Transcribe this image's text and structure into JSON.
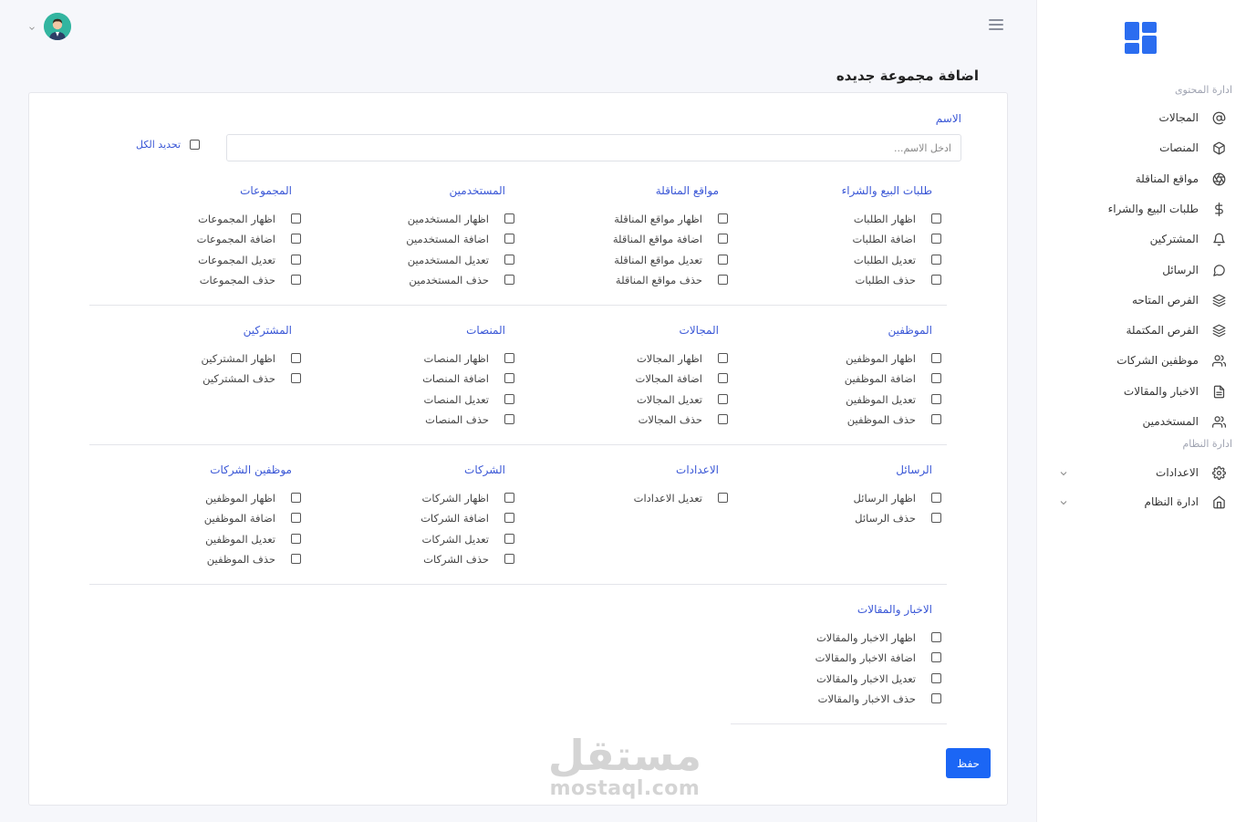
{
  "page_title": "اضافة مجموعة جديده",
  "form": {
    "name_label": "الاسم",
    "name_placeholder": "ادخل الاسم...",
    "name_value": "",
    "select_all_label": "تحديد الكل",
    "save_label": "حفظ"
  },
  "groups": [
    {
      "title": "طلبات البيع والشراء",
      "items": [
        "اظهار الطلبات",
        "اضافة الطلبات",
        "تعديل الطلبات",
        "حذف الطلبات"
      ]
    },
    {
      "title": "مواقع المناقلة",
      "items": [
        "اظهار مواقع المناقلة",
        "اضافة مواقع المناقلة",
        "تعديل مواقع المناقلة",
        "حذف مواقع المناقلة"
      ]
    },
    {
      "title": "المستخدمين",
      "items": [
        "اظهار المستخدمين",
        "اضافة المستخدمين",
        "تعديل المستخدمين",
        "حذف المستخدمين"
      ]
    },
    {
      "title": "المجموعات",
      "items": [
        "اظهار المجموعات",
        "اضافة المجموعات",
        "تعديل المجموعات",
        "حذف المجموعات"
      ]
    },
    {
      "title": "الموظفين",
      "items": [
        "اظهار الموظفين",
        "اضافة الموظفين",
        "تعديل الموظفين",
        "حذف الموظفين"
      ]
    },
    {
      "title": "المجالات",
      "items": [
        "اظهار المجالات",
        "اضافة المجالات",
        "تعديل المجالات",
        "حذف المجالات"
      ]
    },
    {
      "title": "المنصات",
      "items": [
        "اظهار المنصات",
        "اضافة المنصات",
        "تعديل المنصات",
        "حذف المنصات"
      ]
    },
    {
      "title": "المشتركين",
      "items": [
        "اظهار المشتركين",
        "حذف المشتركين"
      ]
    },
    {
      "title": "الرسائل",
      "items": [
        "اظهار الرسائل",
        "حذف الرسائل"
      ]
    },
    {
      "title": "الاعدادات",
      "items": [
        "تعديل الاعدادات"
      ]
    },
    {
      "title": "الشركات",
      "items": [
        "اظهار الشركات",
        "اضافة الشركات",
        "تعديل الشركات",
        "حذف الشركات"
      ]
    },
    {
      "title": "موظفين الشركات",
      "items": [
        "اظهار الموظفين",
        "اضافة الموظفين",
        "تعديل الموظفين",
        "حذف الموظفين"
      ]
    },
    {
      "title": "الاخبار والمقالات",
      "items": [
        "اظهار الاخبار والمقالات",
        "اضافة الاخبار والمقالات",
        "تعديل الاخبار والمقالات",
        "حذف الاخبار والمقالات"
      ]
    }
  ],
  "sidebar": {
    "section_content": "ادارة المحتوى",
    "section_system": "ادارة النظام",
    "items": [
      {
        "label": "المجالات",
        "icon": "at-icon"
      },
      {
        "label": "المنصات",
        "icon": "box-icon"
      },
      {
        "label": "مواقع المناقلة",
        "icon": "aperture-icon"
      },
      {
        "label": "طلبات البيع والشراء",
        "icon": "dollar-icon"
      },
      {
        "label": "المشتركين",
        "icon": "bell-icon"
      },
      {
        "label": "الرسائل",
        "icon": "message-icon"
      },
      {
        "label": "الفرص المتاحه",
        "icon": "layers-icon"
      },
      {
        "label": "الفرص المكتملة",
        "icon": "layers-icon"
      },
      {
        "label": "موظفين الشركات",
        "icon": "users-icon"
      },
      {
        "label": "الاخبار والمقالات",
        "icon": "file-text-icon"
      },
      {
        "label": "المستخدمين",
        "icon": "users-icon"
      },
      {
        "label": "الاعدادات",
        "icon": "gear-icon"
      },
      {
        "label": "ادارة النظام",
        "icon": "home-icon"
      }
    ]
  },
  "watermark": {
    "arabic": "مستقل",
    "latin": "mostaql.com"
  },
  "colors": {
    "accent": "#1b66f5",
    "link": "#3a57d6",
    "avatar": "#33b5a0"
  }
}
